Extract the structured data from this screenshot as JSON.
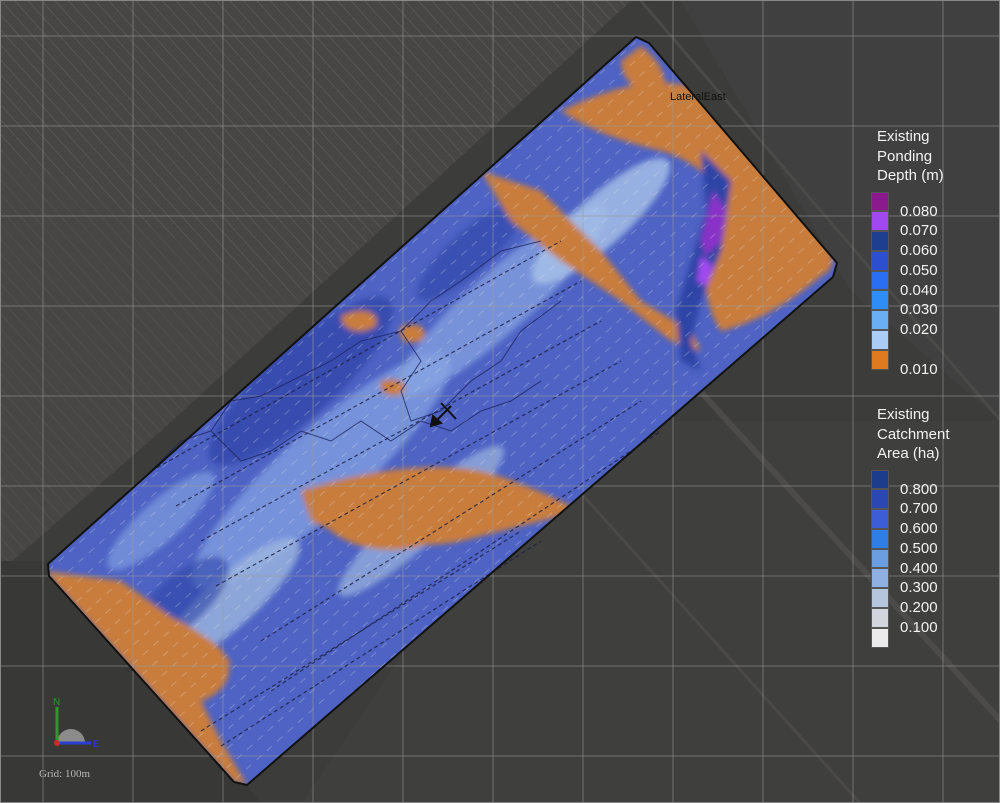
{
  "map": {
    "field_label": "LateralEast",
    "grid_label": "Grid: 100m",
    "compass": {
      "north": "N",
      "east": "E"
    }
  },
  "legends": {
    "ponding": {
      "title_lines": [
        "Existing",
        "Ponding",
        "Depth (m)"
      ],
      "items": [
        {
          "label": "0.080",
          "color": "#8b1a8f"
        },
        {
          "label": "0.070",
          "color": "#a148f0"
        },
        {
          "label": "0.060",
          "color": "#1e3f8f"
        },
        {
          "label": "0.050",
          "color": "#2b4fd0"
        },
        {
          "label": "0.040",
          "color": "#2a6ff2"
        },
        {
          "label": "0.030",
          "color": "#2f8df8"
        },
        {
          "label": "0.020",
          "color": "#6aaef3"
        },
        {
          "label": "",
          "color": "#a9cdf4"
        },
        {
          "label": "0.010",
          "color": "#e07a1f"
        }
      ]
    },
    "catchment": {
      "title_lines": [
        "Existing",
        "Catchment",
        "Area (ha)"
      ],
      "items": [
        {
          "label": "0.800",
          "color": "#1e3c8c"
        },
        {
          "label": "0.700",
          "color": "#2a47b4"
        },
        {
          "label": "0.600",
          "color": "#3c5dd5"
        },
        {
          "label": "0.500",
          "color": "#2f7ee6"
        },
        {
          "label": "0.400",
          "color": "#6a9ee0"
        },
        {
          "label": "0.300",
          "color": "#8eb0e2"
        },
        {
          "label": "0.200",
          "color": "#b4c5dc"
        },
        {
          "label": "0.100",
          "color": "#d2d6dc"
        },
        {
          "label": "",
          "color": "#ebebeb"
        }
      ]
    }
  },
  "colors": {
    "background": "#3c3c3a",
    "field_blue": "#4e63c4",
    "field_orange": "#c97d3c",
    "field_light_blue": "#9db6df",
    "field_dark_blue": "#2a3b8a",
    "field_purple": "#8a33c8",
    "grid_line": "#8f8f8f",
    "boundary": "#111111"
  }
}
